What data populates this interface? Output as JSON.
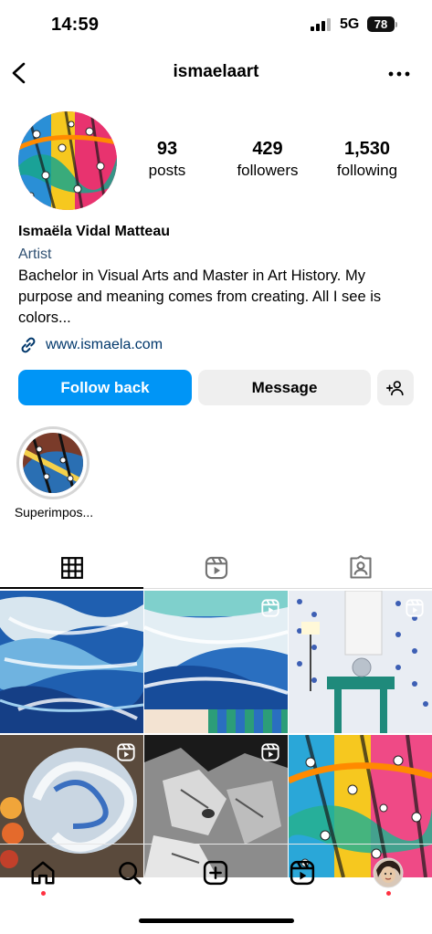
{
  "status_bar": {
    "time": "14:59",
    "network": "5G",
    "battery": "78"
  },
  "header": {
    "username": "ismaelaart"
  },
  "profile": {
    "stats": [
      {
        "value": "93",
        "label": "posts"
      },
      {
        "value": "429",
        "label": "followers"
      },
      {
        "value": "1,530",
        "label": "following"
      }
    ],
    "name": "Ismaëla Vidal Matteau",
    "category": "Artist",
    "bio": "Bachelor in Visual Arts and Master in Art History. My purpose and meaning comes from creating. All I see is colors...",
    "link": "www.ismaela.com"
  },
  "buttons": {
    "follow": "Follow back",
    "message": "Message"
  },
  "highlights": [
    {
      "label": "Superimpos..."
    }
  ],
  "tabs": [
    {
      "name": "grid-icon"
    },
    {
      "name": "reels-icon"
    },
    {
      "name": "tagged-icon"
    }
  ],
  "grid": [
    {
      "subject": "blue ocean waves painting",
      "reel": false
    },
    {
      "subject": "ocean painting with striped frame",
      "reel": true
    },
    {
      "subject": "studio vanity desk with lamp",
      "reel": true
    },
    {
      "subject": "paint palette with brush",
      "reel": true
    },
    {
      "subject": "black and white crumpled paper",
      "reel": true
    },
    {
      "subject": "colorful abstract painting",
      "reel": false
    }
  ],
  "colors": {
    "accent": "#0095f6",
    "link": "#00376b",
    "category": "#2f5072",
    "notification": "#ff3040"
  }
}
